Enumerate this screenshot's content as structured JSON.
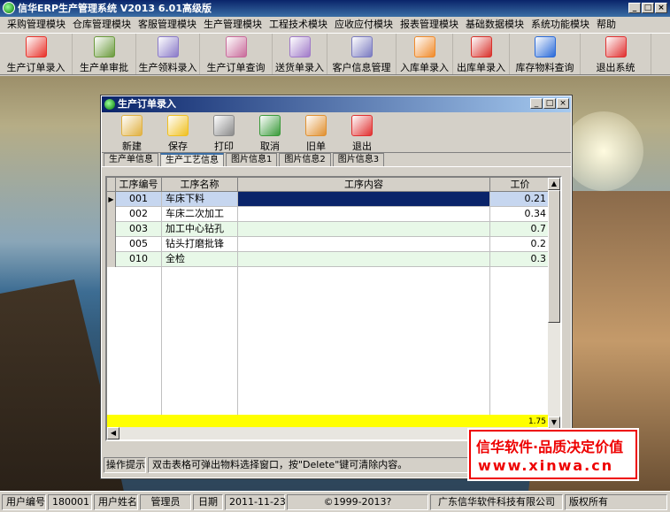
{
  "app": {
    "title": "信华ERP生产管理系统  V2013 6.01高级版",
    "win_min": "_",
    "win_max": "□",
    "win_close": "×"
  },
  "menubar": [
    "采购管理模块",
    "仓库管理模块",
    "客服管理模块",
    "生产管理模块",
    "工程技术模块",
    "应收应付模块",
    "报表管理模块",
    "基础数据模块",
    "系统功能模块",
    "帮助"
  ],
  "toolbar": [
    {
      "label": "生产订单录入",
      "icon": "pdf-icon",
      "color": "#e8322a"
    },
    {
      "label": "生产单审批",
      "icon": "pen-check-icon",
      "color": "#6a9a3c"
    },
    {
      "label": "生产领料录入",
      "icon": "document-edit-icon",
      "color": "#8a7ac8"
    },
    {
      "label": "生产订单查询",
      "icon": "document-search-icon",
      "color": "#c86a9a"
    },
    {
      "label": "送货单录入",
      "icon": "document-pen-icon",
      "color": "#a07ac8"
    },
    {
      "label": "客户信息管理",
      "icon": "document-user-icon",
      "color": "#7a7ac0"
    },
    {
      "label": "入库单录入",
      "icon": "flower-icon",
      "color": "#f08a2a"
    },
    {
      "label": "出库单录入",
      "icon": "book-red-icon",
      "color": "#d8302a"
    },
    {
      "label": "库存物料查询",
      "icon": "feather-pen-icon",
      "color": "#2a6ad8"
    },
    {
      "label": "退出系统",
      "icon": "power-icon",
      "color": "#e03030"
    }
  ],
  "child_window": {
    "title": "生产订单录入",
    "toolbar": [
      {
        "label": "新建",
        "icon": "clipboard-icon",
        "color": "#e0b040"
      },
      {
        "label": "保存",
        "icon": "floppy-icon",
        "color": "#f0c020"
      },
      {
        "label": "打印",
        "icon": "printer-icon",
        "color": "#8a8a8a"
      },
      {
        "label": "取消",
        "icon": "undo-icon",
        "color": "#3a9a3a"
      },
      {
        "label": "旧单",
        "icon": "books-icon",
        "color": "#e09030"
      },
      {
        "label": "退出",
        "icon": "power-icon",
        "color": "#e03030"
      }
    ],
    "tabs": [
      "生产单信息",
      "生产工艺信息",
      "图片信息1",
      "图片信息2",
      "图片信息3"
    ],
    "active_tab": "生产工艺信息",
    "grid": {
      "columns": [
        "工序编号",
        "工序名称",
        "工序内容",
        "工价"
      ],
      "rows": [
        {
          "code": "001",
          "name": "车床下料",
          "content": "",
          "price": "0.21"
        },
        {
          "code": "002",
          "name": "车床二次加工",
          "content": "",
          "price": "0.34"
        },
        {
          "code": "003",
          "name": "加工中心钻孔",
          "content": "",
          "price": "0.7"
        },
        {
          "code": "005",
          "name": "钻头打磨批锋",
          "content": "",
          "price": "0.2"
        },
        {
          "code": "010",
          "name": "全检",
          "content": "",
          "price": "0.3"
        }
      ],
      "total_price": "1.75"
    },
    "hint_label": "操作提示",
    "hint_text": "双击表格可弹出物料选择窗口，按\"Delete\"键可清除内容。"
  },
  "stamp": {
    "line1": "信华软件·品质决定价值",
    "line2": "www.xinwa.cn"
  },
  "statusbar": {
    "user_id_label": "用户编号",
    "user_id": "180001",
    "user_name_label": "用户姓名",
    "user_name": "管理员",
    "date_label": "日期",
    "date": "2011-11-23",
    "copyright": "©1999-2013?",
    "company": "广东信华软件科技有限公司",
    "rights": "版权所有"
  },
  "colors": {
    "title_bar": "#0a246a",
    "row_selected": "#c6d6ef",
    "row_alt": "#e8f8e8",
    "total_row": "#ffff00",
    "stamp_red": "#e00000"
  }
}
